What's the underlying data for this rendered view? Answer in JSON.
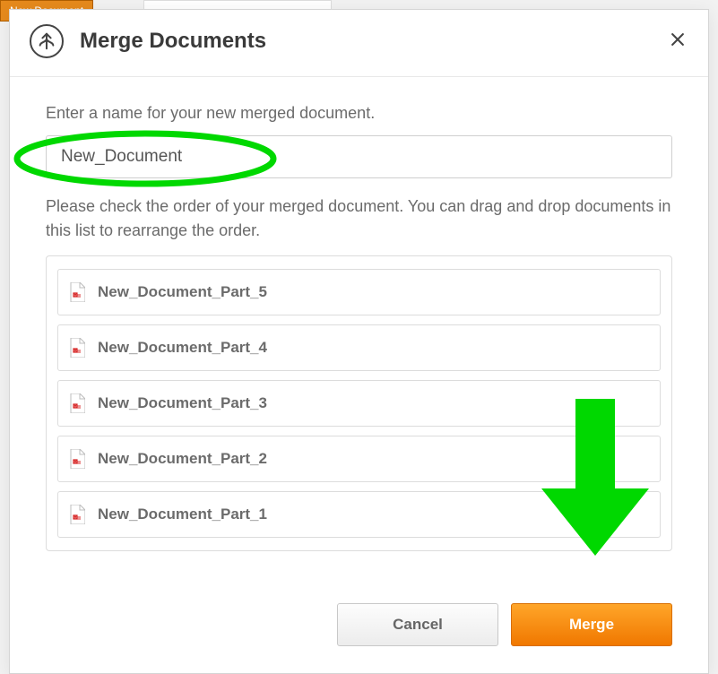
{
  "background": {
    "new_doc_button": "New Document"
  },
  "modal": {
    "title": "Merge Documents",
    "name_prompt": "Enter a name for your new merged document.",
    "name_value": "New_Document",
    "order_prompt": "Please check the order of your merged document. You can drag and drop documents in this list to rearrange the order.",
    "docs": [
      {
        "name": "New_Document_Part_5"
      },
      {
        "name": "New_Document_Part_4"
      },
      {
        "name": "New_Document_Part_3"
      },
      {
        "name": "New_Document_Part_2"
      },
      {
        "name": "New_Document_Part_1"
      }
    ],
    "cancel_label": "Cancel",
    "merge_label": "Merge"
  },
  "annotations": {
    "ellipse_color": "#00d800",
    "arrow_color": "#00d800"
  }
}
